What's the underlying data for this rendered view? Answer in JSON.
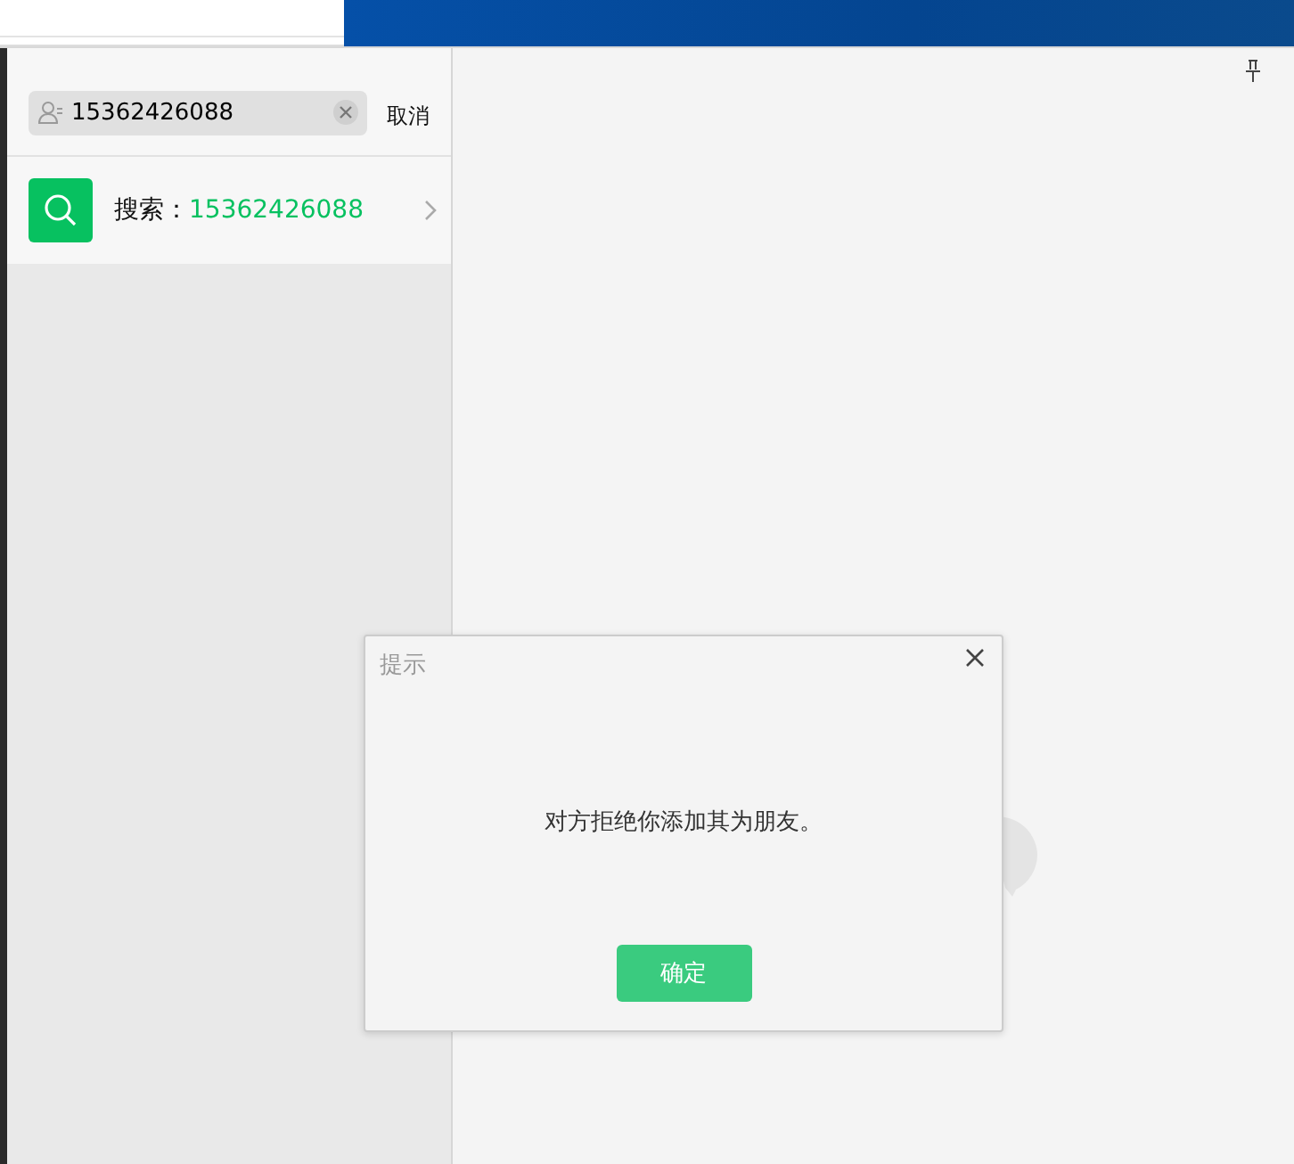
{
  "search": {
    "value": "15362426088",
    "cancel": "取消"
  },
  "result": {
    "label": "搜索：",
    "query": "15362426088"
  },
  "dialog": {
    "title": "提示",
    "message": "对方拒绝你添加其为朋友。",
    "button": "确定"
  }
}
